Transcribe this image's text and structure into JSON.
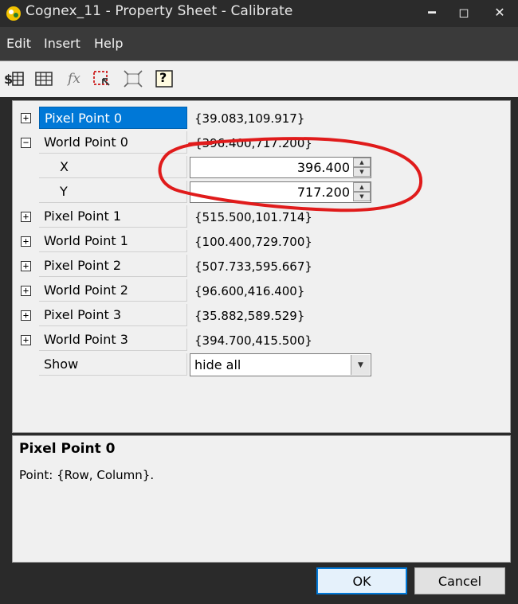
{
  "window": {
    "title": "Cognex_11 - Property Sheet - Calibrate",
    "controls": {
      "minimize": "━",
      "maximize": "◻",
      "close": "✕"
    }
  },
  "menu": {
    "items": [
      "Edit",
      "Insert",
      "Help"
    ]
  },
  "toolbar": {
    "icons": [
      "dollar-grid-icon",
      "grid-icon",
      "fx-icon",
      "selection-icon",
      "fit-icon",
      "help-icon"
    ],
    "fx_label": "fx",
    "help_label": "?"
  },
  "grid": {
    "rows": [
      {
        "name": "Pixel Point 0",
        "value": "{39.083,109.917}",
        "expander": "+"
      },
      {
        "name": "World Point 0",
        "value": "{396.400,717.200}",
        "expander": "−"
      },
      {
        "name": "X",
        "value": "396.400"
      },
      {
        "name": "Y",
        "value": "717.200"
      },
      {
        "name": "Pixel Point 1",
        "value": "{515.500,101.714}",
        "expander": "+"
      },
      {
        "name": "World Point 1",
        "value": "{100.400,729.700}",
        "expander": "+"
      },
      {
        "name": "Pixel Point 2",
        "value": "{507.733,595.667}",
        "expander": "+"
      },
      {
        "name": "World Point 2",
        "value": "{96.600,416.400}",
        "expander": "+"
      },
      {
        "name": "Pixel Point 3",
        "value": "{35.882,589.529}",
        "expander": "+"
      },
      {
        "name": "World Point 3",
        "value": "{394.700,415.500}",
        "expander": "+"
      },
      {
        "name": "Show",
        "value": "hide all"
      }
    ]
  },
  "description": {
    "title": "Pixel Point 0",
    "text": "Point: {Row, Column}."
  },
  "buttons": {
    "ok": "OK",
    "cancel": "Cancel"
  },
  "colors": {
    "selection": "#0078d7",
    "annotation": "#e01b1b"
  }
}
